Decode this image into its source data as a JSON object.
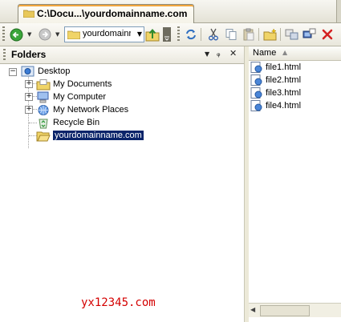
{
  "tab": {
    "title": "C:\\Docu...\\yourdomainname.com"
  },
  "toolbar": {
    "address_value": "yourdomainr",
    "buttons": [
      "back",
      "forward",
      "up",
      "refresh",
      "cut",
      "copy",
      "paste",
      "new-folder",
      "move-to",
      "copy-to",
      "delete"
    ]
  },
  "folders_panel": {
    "title": "Folders",
    "tree": [
      {
        "label": "Desktop"
      },
      {
        "label": "My Documents"
      },
      {
        "label": "My Computer"
      },
      {
        "label": "My Network Places"
      },
      {
        "label": "Recycle Bin"
      },
      {
        "label": "yourdomainname.com",
        "selected": true
      }
    ]
  },
  "file_list": {
    "column_header": "Name",
    "files": [
      "file1.html",
      "file2.html",
      "file3.html",
      "file4.html"
    ]
  },
  "watermark": "yx12345.com",
  "colors": {
    "selection": "#0a246a",
    "watermark": "#d40000",
    "tab_accent": "#f2a63d"
  }
}
